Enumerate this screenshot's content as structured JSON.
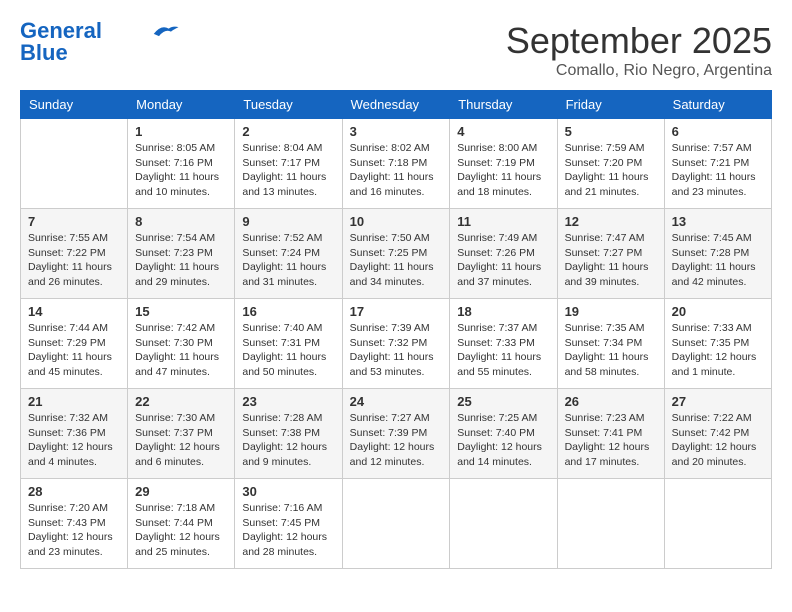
{
  "logo": {
    "line1": "General",
    "line2": "Blue"
  },
  "title": "September 2025",
  "subtitle": "Comallo, Rio Negro, Argentina",
  "days_of_week": [
    "Sunday",
    "Monday",
    "Tuesday",
    "Wednesday",
    "Thursday",
    "Friday",
    "Saturday"
  ],
  "weeks": [
    [
      {
        "day": "",
        "info": ""
      },
      {
        "day": "1",
        "info": "Sunrise: 8:05 AM\nSunset: 7:16 PM\nDaylight: 11 hours\nand 10 minutes."
      },
      {
        "day": "2",
        "info": "Sunrise: 8:04 AM\nSunset: 7:17 PM\nDaylight: 11 hours\nand 13 minutes."
      },
      {
        "day": "3",
        "info": "Sunrise: 8:02 AM\nSunset: 7:18 PM\nDaylight: 11 hours\nand 16 minutes."
      },
      {
        "day": "4",
        "info": "Sunrise: 8:00 AM\nSunset: 7:19 PM\nDaylight: 11 hours\nand 18 minutes."
      },
      {
        "day": "5",
        "info": "Sunrise: 7:59 AM\nSunset: 7:20 PM\nDaylight: 11 hours\nand 21 minutes."
      },
      {
        "day": "6",
        "info": "Sunrise: 7:57 AM\nSunset: 7:21 PM\nDaylight: 11 hours\nand 23 minutes."
      }
    ],
    [
      {
        "day": "7",
        "info": "Sunrise: 7:55 AM\nSunset: 7:22 PM\nDaylight: 11 hours\nand 26 minutes."
      },
      {
        "day": "8",
        "info": "Sunrise: 7:54 AM\nSunset: 7:23 PM\nDaylight: 11 hours\nand 29 minutes."
      },
      {
        "day": "9",
        "info": "Sunrise: 7:52 AM\nSunset: 7:24 PM\nDaylight: 11 hours\nand 31 minutes."
      },
      {
        "day": "10",
        "info": "Sunrise: 7:50 AM\nSunset: 7:25 PM\nDaylight: 11 hours\nand 34 minutes."
      },
      {
        "day": "11",
        "info": "Sunrise: 7:49 AM\nSunset: 7:26 PM\nDaylight: 11 hours\nand 37 minutes."
      },
      {
        "day": "12",
        "info": "Sunrise: 7:47 AM\nSunset: 7:27 PM\nDaylight: 11 hours\nand 39 minutes."
      },
      {
        "day": "13",
        "info": "Sunrise: 7:45 AM\nSunset: 7:28 PM\nDaylight: 11 hours\nand 42 minutes."
      }
    ],
    [
      {
        "day": "14",
        "info": "Sunrise: 7:44 AM\nSunset: 7:29 PM\nDaylight: 11 hours\nand 45 minutes."
      },
      {
        "day": "15",
        "info": "Sunrise: 7:42 AM\nSunset: 7:30 PM\nDaylight: 11 hours\nand 47 minutes."
      },
      {
        "day": "16",
        "info": "Sunrise: 7:40 AM\nSunset: 7:31 PM\nDaylight: 11 hours\nand 50 minutes."
      },
      {
        "day": "17",
        "info": "Sunrise: 7:39 AM\nSunset: 7:32 PM\nDaylight: 11 hours\nand 53 minutes."
      },
      {
        "day": "18",
        "info": "Sunrise: 7:37 AM\nSunset: 7:33 PM\nDaylight: 11 hours\nand 55 minutes."
      },
      {
        "day": "19",
        "info": "Sunrise: 7:35 AM\nSunset: 7:34 PM\nDaylight: 11 hours\nand 58 minutes."
      },
      {
        "day": "20",
        "info": "Sunrise: 7:33 AM\nSunset: 7:35 PM\nDaylight: 12 hours\nand 1 minute."
      }
    ],
    [
      {
        "day": "21",
        "info": "Sunrise: 7:32 AM\nSunset: 7:36 PM\nDaylight: 12 hours\nand 4 minutes."
      },
      {
        "day": "22",
        "info": "Sunrise: 7:30 AM\nSunset: 7:37 PM\nDaylight: 12 hours\nand 6 minutes."
      },
      {
        "day": "23",
        "info": "Sunrise: 7:28 AM\nSunset: 7:38 PM\nDaylight: 12 hours\nand 9 minutes."
      },
      {
        "day": "24",
        "info": "Sunrise: 7:27 AM\nSunset: 7:39 PM\nDaylight: 12 hours\nand 12 minutes."
      },
      {
        "day": "25",
        "info": "Sunrise: 7:25 AM\nSunset: 7:40 PM\nDaylight: 12 hours\nand 14 minutes."
      },
      {
        "day": "26",
        "info": "Sunrise: 7:23 AM\nSunset: 7:41 PM\nDaylight: 12 hours\nand 17 minutes."
      },
      {
        "day": "27",
        "info": "Sunrise: 7:22 AM\nSunset: 7:42 PM\nDaylight: 12 hours\nand 20 minutes."
      }
    ],
    [
      {
        "day": "28",
        "info": "Sunrise: 7:20 AM\nSunset: 7:43 PM\nDaylight: 12 hours\nand 23 minutes."
      },
      {
        "day": "29",
        "info": "Sunrise: 7:18 AM\nSunset: 7:44 PM\nDaylight: 12 hours\nand 25 minutes."
      },
      {
        "day": "30",
        "info": "Sunrise: 7:16 AM\nSunset: 7:45 PM\nDaylight: 12 hours\nand 28 minutes."
      },
      {
        "day": "",
        "info": ""
      },
      {
        "day": "",
        "info": ""
      },
      {
        "day": "",
        "info": ""
      },
      {
        "day": "",
        "info": ""
      }
    ]
  ]
}
